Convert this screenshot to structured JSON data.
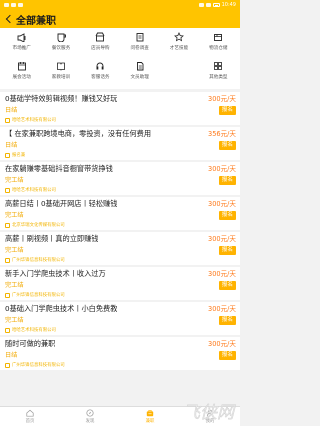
{
  "status": {
    "time": "10:49"
  },
  "header": {
    "title": "全部兼职"
  },
  "categories": [
    {
      "label": "市场推广",
      "icon": "megaphone-icon"
    },
    {
      "label": "餐饮服务",
      "icon": "cup-icon"
    },
    {
      "label": "店员导购",
      "icon": "store-icon"
    },
    {
      "label": "问卷调查",
      "icon": "clipboard-icon"
    },
    {
      "label": "才艺技能",
      "icon": "star-icon"
    },
    {
      "label": "物流仓储",
      "icon": "box-icon"
    },
    {
      "label": "展会活动",
      "icon": "calendar-icon"
    },
    {
      "label": "家教培训",
      "icon": "book-icon"
    },
    {
      "label": "客服话务",
      "icon": "headset-icon"
    },
    {
      "label": "文员助理",
      "icon": "document-icon"
    },
    {
      "label": "",
      "icon": "blank"
    },
    {
      "label": "其他类型",
      "icon": "grid-icon"
    }
  ],
  "jobs": [
    {
      "title": "0基础学特效剪辑视频！赚钱又好玩",
      "salary": "300元/天",
      "location": "日结",
      "button": "报名",
      "company": "哈哈艺术科技有限公司"
    },
    {
      "title": "【 在家兼职跨境电商，零投资，没有任何费用",
      "salary": "356元/天",
      "location": "日结",
      "button": "报名",
      "company": "报名兼"
    },
    {
      "title": "在家躺赚零基础抖音橱窗带货挣钱",
      "salary": "300元/天",
      "location": "完工结",
      "button": "报名",
      "company": "哈哈艺术科技有限公司"
    },
    {
      "title": "高薪日结丨0基础开网店丨轻松赚钱",
      "salary": "300元/天",
      "location": "完工结",
      "button": "报名",
      "company": "北京华瑞文化传媒有限公司"
    },
    {
      "title": "高薪丨刷视频丨真的立即赚钱",
      "salary": "300元/天",
      "location": "完工结",
      "button": "报名",
      "company": "广州华锋信息科技有限公司"
    },
    {
      "title": "新手入门学爬虫技术丨收入过万",
      "salary": "300元/天",
      "location": "完工结",
      "button": "报名",
      "company": "广州华锋信息科技有限公司"
    },
    {
      "title": "0基础入门学爬虫技术丨小白免费教",
      "salary": "300元/天",
      "location": "完工结",
      "button": "报名",
      "company": "哈哈艺术科技有限公司"
    },
    {
      "title": "随时可做的兼职",
      "salary": "300元/天",
      "location": "日结",
      "button": "报名",
      "company": "广州华锋信息科技有限公司"
    }
  ],
  "tabs": [
    {
      "label": "首页",
      "icon": "home-icon",
      "active": false
    },
    {
      "label": "发现",
      "icon": "compass-icon",
      "active": false
    },
    {
      "label": "兼职",
      "icon": "briefcase-icon",
      "active": true
    },
    {
      "label": "我的",
      "icon": "user-icon",
      "active": false
    }
  ],
  "watermark": {
    "text": "飞侠网"
  },
  "colors": {
    "brand": "#ffc400",
    "salary": "#ff7a1a",
    "button": "#ffb300"
  }
}
